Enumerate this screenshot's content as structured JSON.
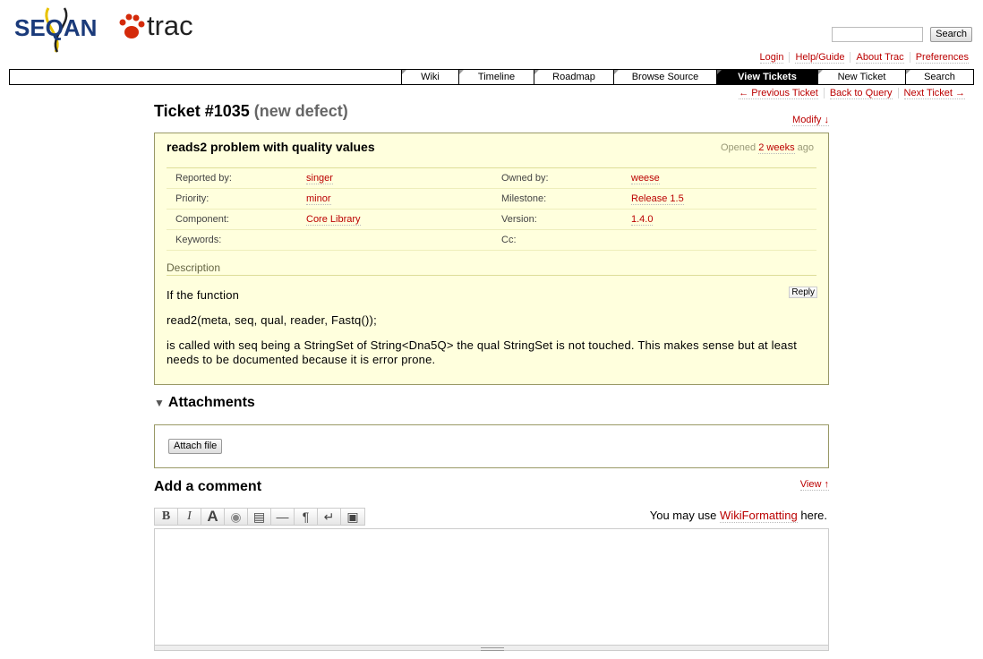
{
  "logo": {
    "seqan_text": "SEQAN",
    "trac_text": "trac"
  },
  "search": {
    "input_value": "",
    "button_label": "Search"
  },
  "metanav": [
    "Login",
    "Help/Guide",
    "About Trac",
    "Preferences"
  ],
  "mainnav": [
    "Wiki",
    "Timeline",
    "Roadmap",
    "Browse Source",
    "View Tickets",
    "New Ticket",
    "Search"
  ],
  "mainnav_active": "View Tickets",
  "ctxnav": [
    "← Previous Ticket",
    "Back to Query",
    "Next Ticket →"
  ],
  "ticket": {
    "id": "Ticket #1035",
    "status": "(new defect)",
    "modify_label": "Modify ↓",
    "summary": "reads2 problem with quality values",
    "opened_prefix": "Opened",
    "opened_ago": "2 weeks",
    "opened_suffix": "ago",
    "props": {
      "reported_by_label": "Reported by:",
      "reported_by": "singer",
      "owned_by_label": "Owned by:",
      "owned_by": "weese",
      "priority_label": "Priority:",
      "priority": "minor",
      "milestone_label": "Milestone:",
      "milestone": "Release 1.5",
      "component_label": "Component:",
      "component": "Core Library",
      "version_label": "Version:",
      "version": "1.4.0",
      "keywords_label": "Keywords:",
      "keywords": "",
      "cc_label": "Cc:",
      "cc": ""
    },
    "description_heading": "Description",
    "reply_label": "Reply",
    "description": [
      "If the function",
      "read2(meta, seq, qual, reader, Fastq());",
      "is called with seq being a StringSet of String<Dna5Q> the qual StringSet is not touched. This makes sense but at least needs to be documented because it is error prone."
    ]
  },
  "attachments": {
    "heading": "Attachments",
    "button_label": "Attach file"
  },
  "comment": {
    "heading": "Add a comment",
    "view_label": "View ↑",
    "hint_prefix": "You may use",
    "hint_link": "WikiFormatting",
    "hint_suffix": "here.",
    "value": "",
    "toolbar": [
      "B",
      "I",
      "A",
      "◉",
      "▤",
      "—",
      "¶",
      "↵",
      "▣"
    ],
    "toolbar_icons": [
      "bold-icon",
      "italic-icon",
      "heading-icon",
      "link-icon",
      "code-block-icon",
      "horizontal-rule-icon",
      "paragraph-icon",
      "line-break-icon",
      "image-icon"
    ]
  }
}
